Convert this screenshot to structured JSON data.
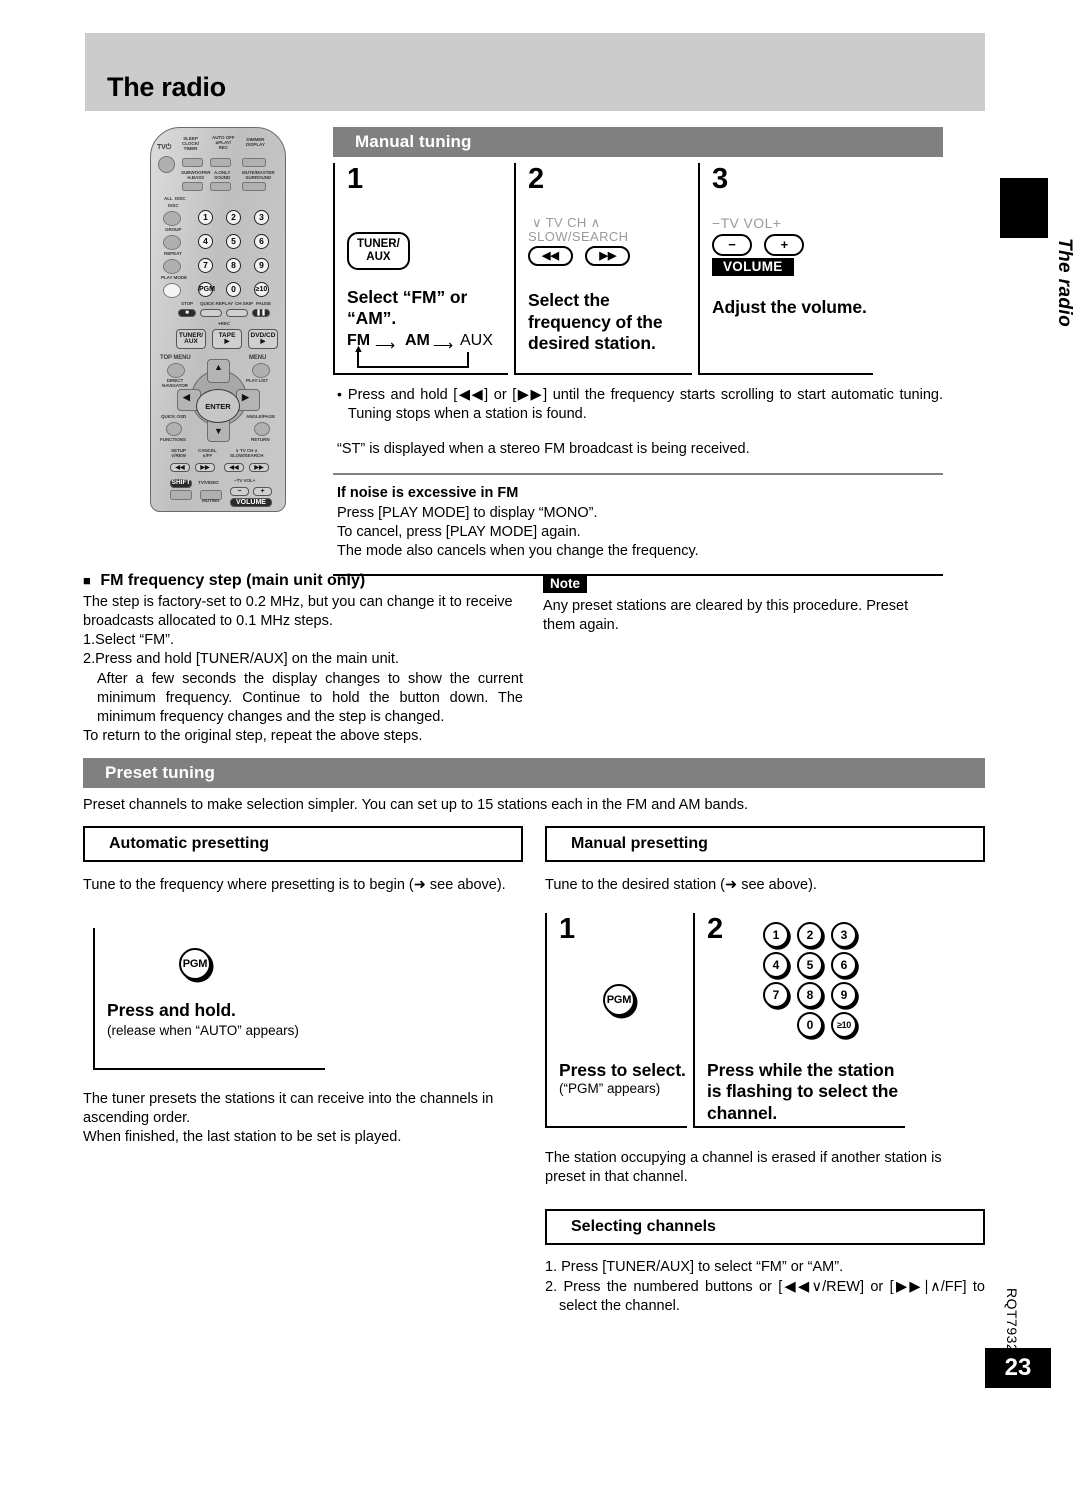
{
  "page": {
    "title": "The radio",
    "side_tab_label": "The radio",
    "doc_code": "RQT7932",
    "page_number": "23",
    "header_bg": "#cccccc",
    "section_bar_bg": "#808080"
  },
  "remote": {
    "labels": {
      "tv_power": "TV",
      "sleep_clock_timer": "SLEEP\nCLOCK/\nTIMER",
      "auto_off_play_rec": "AUTO OFF\nPLAY/\nREC",
      "dimmer_display": "DIMMER\nDISPLAY",
      "subwoofer_h_bass": "SUBWOOFER\nH.BASS",
      "a_only_sound": "A.ONLY\nSOUND",
      "mute_master_surround": "MUTE/MASTER\nSURROUND",
      "all_disc": "ALL  DISC",
      "disc": "DISC",
      "group": "GROUP",
      "repeat": "REPEAT",
      "play_mode": "PLAY MODE",
      "pgm": "PGM",
      "zero": "0",
      "ten_plus": "≥10",
      "stop": "STOP",
      "quick_replay": "QUICK REPLAY",
      "ch_skip": "CH SKIP",
      "pause": "PAUSE",
      "rec": "REC",
      "tuner_aux": "TUNER/\nAUX",
      "tape": "TAPE",
      "dvd_cd": "DVD/CD",
      "top_menu": "TOP MENU",
      "direct_navigator": "DIRECT\nNAVIGATOR",
      "menu": "MENU",
      "play_list": "PLAY LIST",
      "enter": "ENTER",
      "quick_osd": "QUICK OSD",
      "functions": "FUNCTIONS",
      "angle_page": "ANGLE/PAGE",
      "return": "RETURN",
      "setup_vrew": "SETUP\nV/REW",
      "cancel_aff": "CANCEL\n∧/FF",
      "tv_ch": "∨ TV CH ∧",
      "slow_search": "SLOW/SEARCH",
      "shift": "SHIFT",
      "tv_video": "TV/VIDEO",
      "tv_vol": "−TV VOL+",
      "muting": "MUTING",
      "volume": "VOLUME"
    },
    "numbers": [
      "1",
      "2",
      "3",
      "4",
      "5",
      "6",
      "7",
      "8",
      "9"
    ]
  },
  "manual_tuning": {
    "heading": "Manual tuning",
    "steps": [
      {
        "num": "1",
        "button_label": "TUNER/\nAUX",
        "caption": "Select “FM” or “AM”.",
        "cycle": [
          "FM",
          "AM",
          "AUX"
        ]
      },
      {
        "num": "2",
        "top_label_1": "∨ TV CH ∧",
        "top_label_2": "SLOW/SEARCH",
        "button_left": "◀◀",
        "button_right": "▶▶",
        "caption": "Select the frequency of the desired station."
      },
      {
        "num": "3",
        "top_label": "−TV VOL+",
        "button_minus": "−",
        "button_plus": "+",
        "volume_label": "VOLUME",
        "caption": "Adjust the volume."
      }
    ],
    "bullet": "Press and hold [◀◀] or [▶▶] until the frequency starts scrolling to start automatic tuning. Tuning stops when a station is found.",
    "stereo_note": "“ST” is displayed when a stereo FM broadcast is being received.",
    "noise_heading_bold": "If noise is excessive in FM",
    "noise_lines": [
      "Press [PLAY MODE] to display “MONO”.",
      "To cancel, press [PLAY MODE] again.",
      "The mode also cancels when you change the frequency."
    ]
  },
  "fm_step": {
    "heading": "FM frequency step (main unit only)",
    "intro": "The step is factory-set to 0.2 MHz, but you can change it to receive broadcasts allocated to 0.1 MHz steps.",
    "item1": "1.Select “FM”.",
    "item2": "2.Press and hold [TUNER/AUX] on the main unit.",
    "item2_detail": "After a few seconds the display changes to show the current minimum frequency. Continue to hold the button down. The minimum frequency changes and the step is changed.",
    "closing": "To return to the original step, repeat the above steps."
  },
  "note": {
    "tag": "Note",
    "text": "Any preset stations are cleared by this procedure. Preset them again."
  },
  "preset_tuning": {
    "heading": "Preset tuning",
    "intro": "Preset channels to make selection simpler. You can set up to 15 stations each in the FM and AM bands.",
    "automatic": {
      "heading": "Automatic presetting",
      "intro": "Tune to the frequency where presetting is to begin (➜ see above).",
      "button_label": "PGM",
      "caption": "Press and hold.",
      "caption_sub": "(release when “AUTO” appears)",
      "after_lines": [
        "The tuner presets the stations it can receive into the channels in ascending order.",
        "When finished, the last station to be set is played."
      ]
    },
    "manual": {
      "heading": "Manual presetting",
      "intro": "Tune to the desired station (➜ see above).",
      "steps": [
        {
          "num": "1",
          "button_label": "PGM",
          "caption": "Press to select.",
          "caption_sub": "(“PGM” appears)"
        },
        {
          "num": "2",
          "numpad": [
            "1",
            "2",
            "3",
            "4",
            "5",
            "6",
            "7",
            "8",
            "9",
            "0",
            "≥10"
          ],
          "caption": "Press while the station is flashing to select the channel."
        }
      ],
      "after_text": "The station occupying a channel is erased if another station is preset in that channel."
    },
    "selecting_channels": {
      "heading": "Selecting channels",
      "items": [
        "1. Press [TUNER/AUX] to select “FM” or “AM”.",
        "2. Press the numbered buttons or [◀◀∨/REW] or [▶▶∣∧/FF] to select the channel."
      ]
    }
  }
}
